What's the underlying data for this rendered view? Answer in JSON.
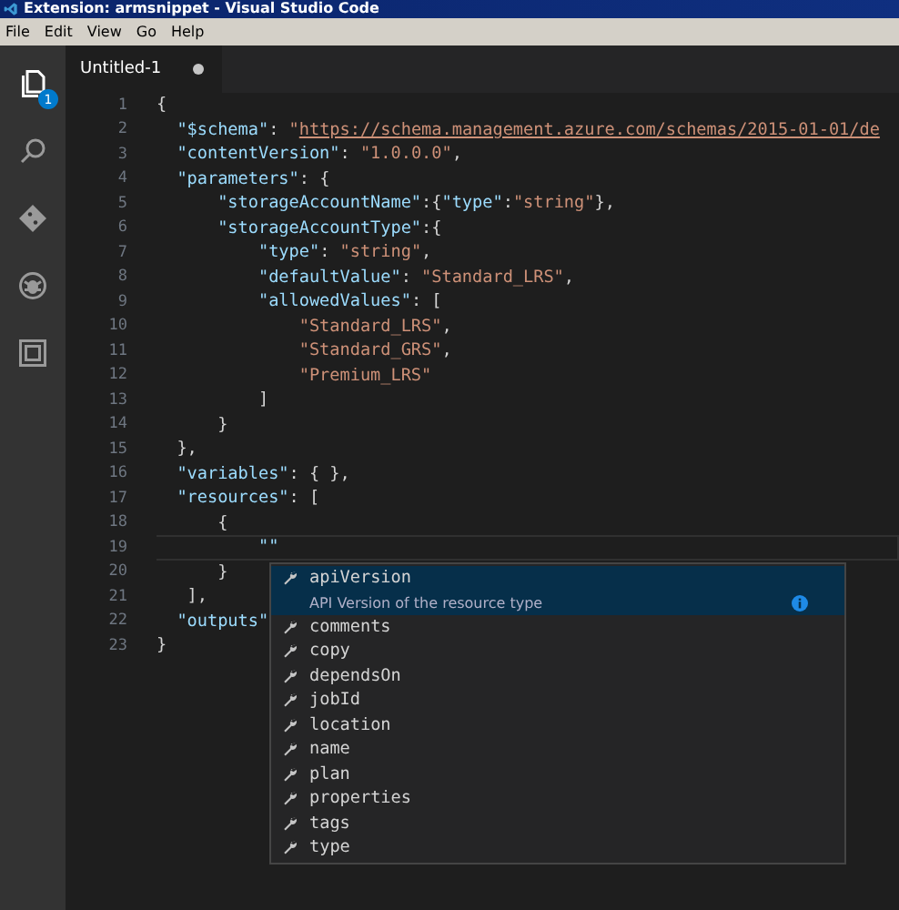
{
  "window": {
    "title": "Extension: armsnippet - Visual Studio Code"
  },
  "menu": [
    "File",
    "Edit",
    "View",
    "Go",
    "Help"
  ],
  "activity_bar": [
    {
      "kind": "files",
      "selected": true,
      "badge": "1"
    },
    {
      "kind": "search",
      "selected": false
    },
    {
      "kind": "git",
      "selected": false
    },
    {
      "kind": "debug",
      "selected": false
    },
    {
      "kind": "extensions",
      "selected": false
    }
  ],
  "tabs": [
    {
      "label": "Untitled-1",
      "selected": true,
      "dirty": true
    }
  ],
  "editor": {
    "lines": [
      {
        "number": "1",
        "current": false,
        "tokens": [
          {
            "text": "{",
            "kind": "punct"
          }
        ]
      },
      {
        "number": "2",
        "current": false,
        "tokens": [
          {
            "text": "  \"$schema\"",
            "kind": "key"
          },
          {
            "text": ": ",
            "kind": "punct"
          },
          {
            "text": "\"",
            "kind": "string"
          },
          {
            "text": "https://schema.management.azure.com/schemas/2015-01-01/de",
            "kind": "link"
          }
        ]
      },
      {
        "number": "3",
        "current": false,
        "tokens": [
          {
            "text": "  \"contentVersion\"",
            "kind": "key"
          },
          {
            "text": ": ",
            "kind": "punct"
          },
          {
            "text": "\"1.0.0.0\"",
            "kind": "string"
          },
          {
            "text": ",",
            "kind": "punct"
          }
        ]
      },
      {
        "number": "4",
        "current": false,
        "tokens": [
          {
            "text": "  \"parameters\"",
            "kind": "key"
          },
          {
            "text": ": {",
            "kind": "punct"
          }
        ]
      },
      {
        "number": "5",
        "current": false,
        "tokens": [
          {
            "text": "      \"storageAccountName\"",
            "kind": "key"
          },
          {
            "text": ":{",
            "kind": "punct"
          },
          {
            "text": "\"type\"",
            "kind": "key"
          },
          {
            "text": ":",
            "kind": "punct"
          },
          {
            "text": "\"string\"",
            "kind": "string"
          },
          {
            "text": "},",
            "kind": "punct"
          }
        ]
      },
      {
        "number": "6",
        "current": false,
        "tokens": [
          {
            "text": "      \"storageAccountType\"",
            "kind": "key"
          },
          {
            "text": ":{",
            "kind": "punct"
          }
        ]
      },
      {
        "number": "7",
        "current": false,
        "tokens": [
          {
            "text": "          \"type\"",
            "kind": "key"
          },
          {
            "text": ": ",
            "kind": "punct"
          },
          {
            "text": "\"string\"",
            "kind": "string"
          },
          {
            "text": ",",
            "kind": "punct"
          }
        ]
      },
      {
        "number": "8",
        "current": false,
        "tokens": [
          {
            "text": "          \"defaultValue\"",
            "kind": "key"
          },
          {
            "text": ": ",
            "kind": "punct"
          },
          {
            "text": "\"Standard_LRS\"",
            "kind": "string"
          },
          {
            "text": ",",
            "kind": "punct"
          }
        ]
      },
      {
        "number": "9",
        "current": false,
        "tokens": [
          {
            "text": "          \"allowedValues\"",
            "kind": "key"
          },
          {
            "text": ": [",
            "kind": "punct"
          }
        ]
      },
      {
        "number": "10",
        "current": false,
        "tokens": [
          {
            "text": "              \"Standard_LRS\"",
            "kind": "string"
          },
          {
            "text": ",",
            "kind": "punct"
          }
        ]
      },
      {
        "number": "11",
        "current": false,
        "tokens": [
          {
            "text": "              \"Standard_GRS\"",
            "kind": "string"
          },
          {
            "text": ",",
            "kind": "punct"
          }
        ]
      },
      {
        "number": "12",
        "current": false,
        "tokens": [
          {
            "text": "              \"Premium_LRS\"",
            "kind": "string"
          }
        ]
      },
      {
        "number": "13",
        "current": false,
        "tokens": [
          {
            "text": "          ]",
            "kind": "punct"
          }
        ]
      },
      {
        "number": "14",
        "current": false,
        "tokens": [
          {
            "text": "      }",
            "kind": "punct"
          }
        ]
      },
      {
        "number": "15",
        "current": false,
        "tokens": [
          {
            "text": "  },",
            "kind": "punct"
          }
        ]
      },
      {
        "number": "16",
        "current": false,
        "tokens": [
          {
            "text": "  \"variables\"",
            "kind": "key"
          },
          {
            "text": ": { },",
            "kind": "punct"
          }
        ]
      },
      {
        "number": "17",
        "current": false,
        "tokens": [
          {
            "text": "  \"resources\"",
            "kind": "key"
          },
          {
            "text": ": [",
            "kind": "punct"
          }
        ]
      },
      {
        "number": "18",
        "current": false,
        "tokens": [
          {
            "text": "      {",
            "kind": "punct"
          }
        ]
      },
      {
        "number": "19",
        "current": true,
        "tokens": [
          {
            "text": "          \"\"",
            "kind": "key"
          }
        ]
      },
      {
        "number": "20",
        "current": false,
        "tokens": [
          {
            "text": "      }",
            "kind": "punct"
          }
        ]
      },
      {
        "number": "21",
        "current": false,
        "tokens": [
          {
            "text": "   ],",
            "kind": "punct"
          }
        ]
      },
      {
        "number": "22",
        "current": false,
        "tokens": [
          {
            "text": "  \"outputs\"",
            "kind": "key"
          }
        ]
      },
      {
        "number": "23",
        "current": false,
        "tokens": [
          {
            "text": "}",
            "kind": "punct"
          }
        ]
      }
    ]
  },
  "suggestions": [
    {
      "label": "apiVersion",
      "selected": true,
      "detail": "API Version of the resource type"
    },
    {
      "label": "comments",
      "selected": false
    },
    {
      "label": "copy",
      "selected": false
    },
    {
      "label": "dependsOn",
      "selected": false
    },
    {
      "label": "jobId",
      "selected": false
    },
    {
      "label": "location",
      "selected": false
    },
    {
      "label": "name",
      "selected": false
    },
    {
      "label": "plan",
      "selected": false
    },
    {
      "label": "properties",
      "selected": false
    },
    {
      "label": "tags",
      "selected": false
    },
    {
      "label": "type",
      "selected": false
    }
  ]
}
